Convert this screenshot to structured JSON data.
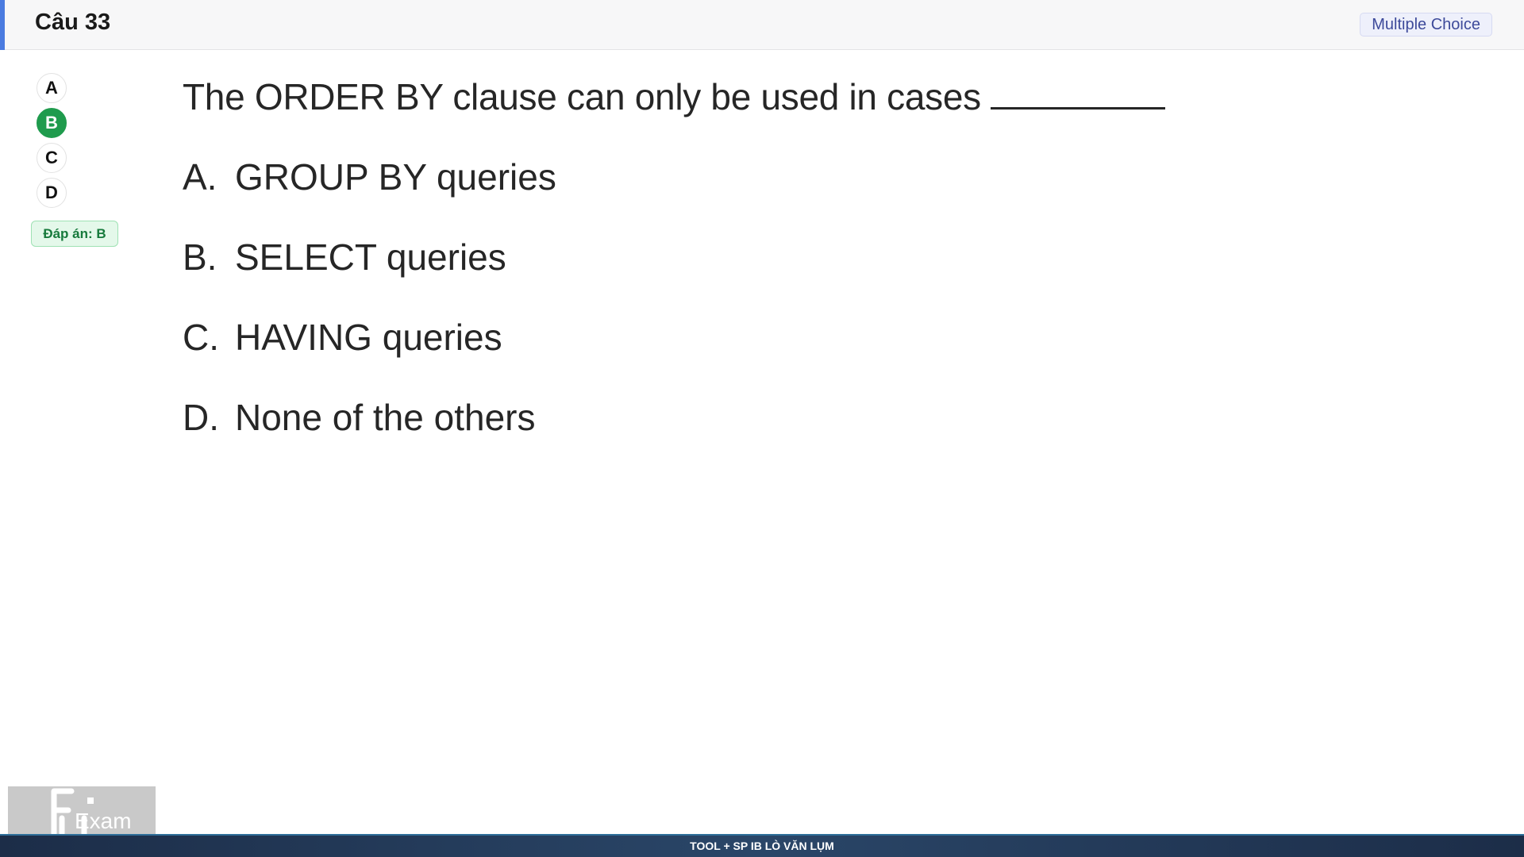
{
  "header": {
    "title": "Câu 33",
    "type_badge": "Multiple Choice",
    "accent_color": "#4a7be0"
  },
  "options": {
    "a": "A",
    "b": "B",
    "c": "C",
    "d": "D",
    "selected": "B",
    "selected_color": "#1f9b4d"
  },
  "answer_badge": "Đáp án: B",
  "question": {
    "text": "The ORDER BY clause can only be used in cases",
    "choices": [
      {
        "letter": "A.",
        "text": "GROUP BY queries"
      },
      {
        "letter": "B.",
        "text": "SELECT queries"
      },
      {
        "letter": "C.",
        "text": "HAVING queries"
      },
      {
        "letter": "D.",
        "text": "None of the others"
      }
    ]
  },
  "logo": {
    "text": "Exam"
  },
  "footer": {
    "text": "TOOL + SP IB LÒ VĂN LỤM"
  }
}
